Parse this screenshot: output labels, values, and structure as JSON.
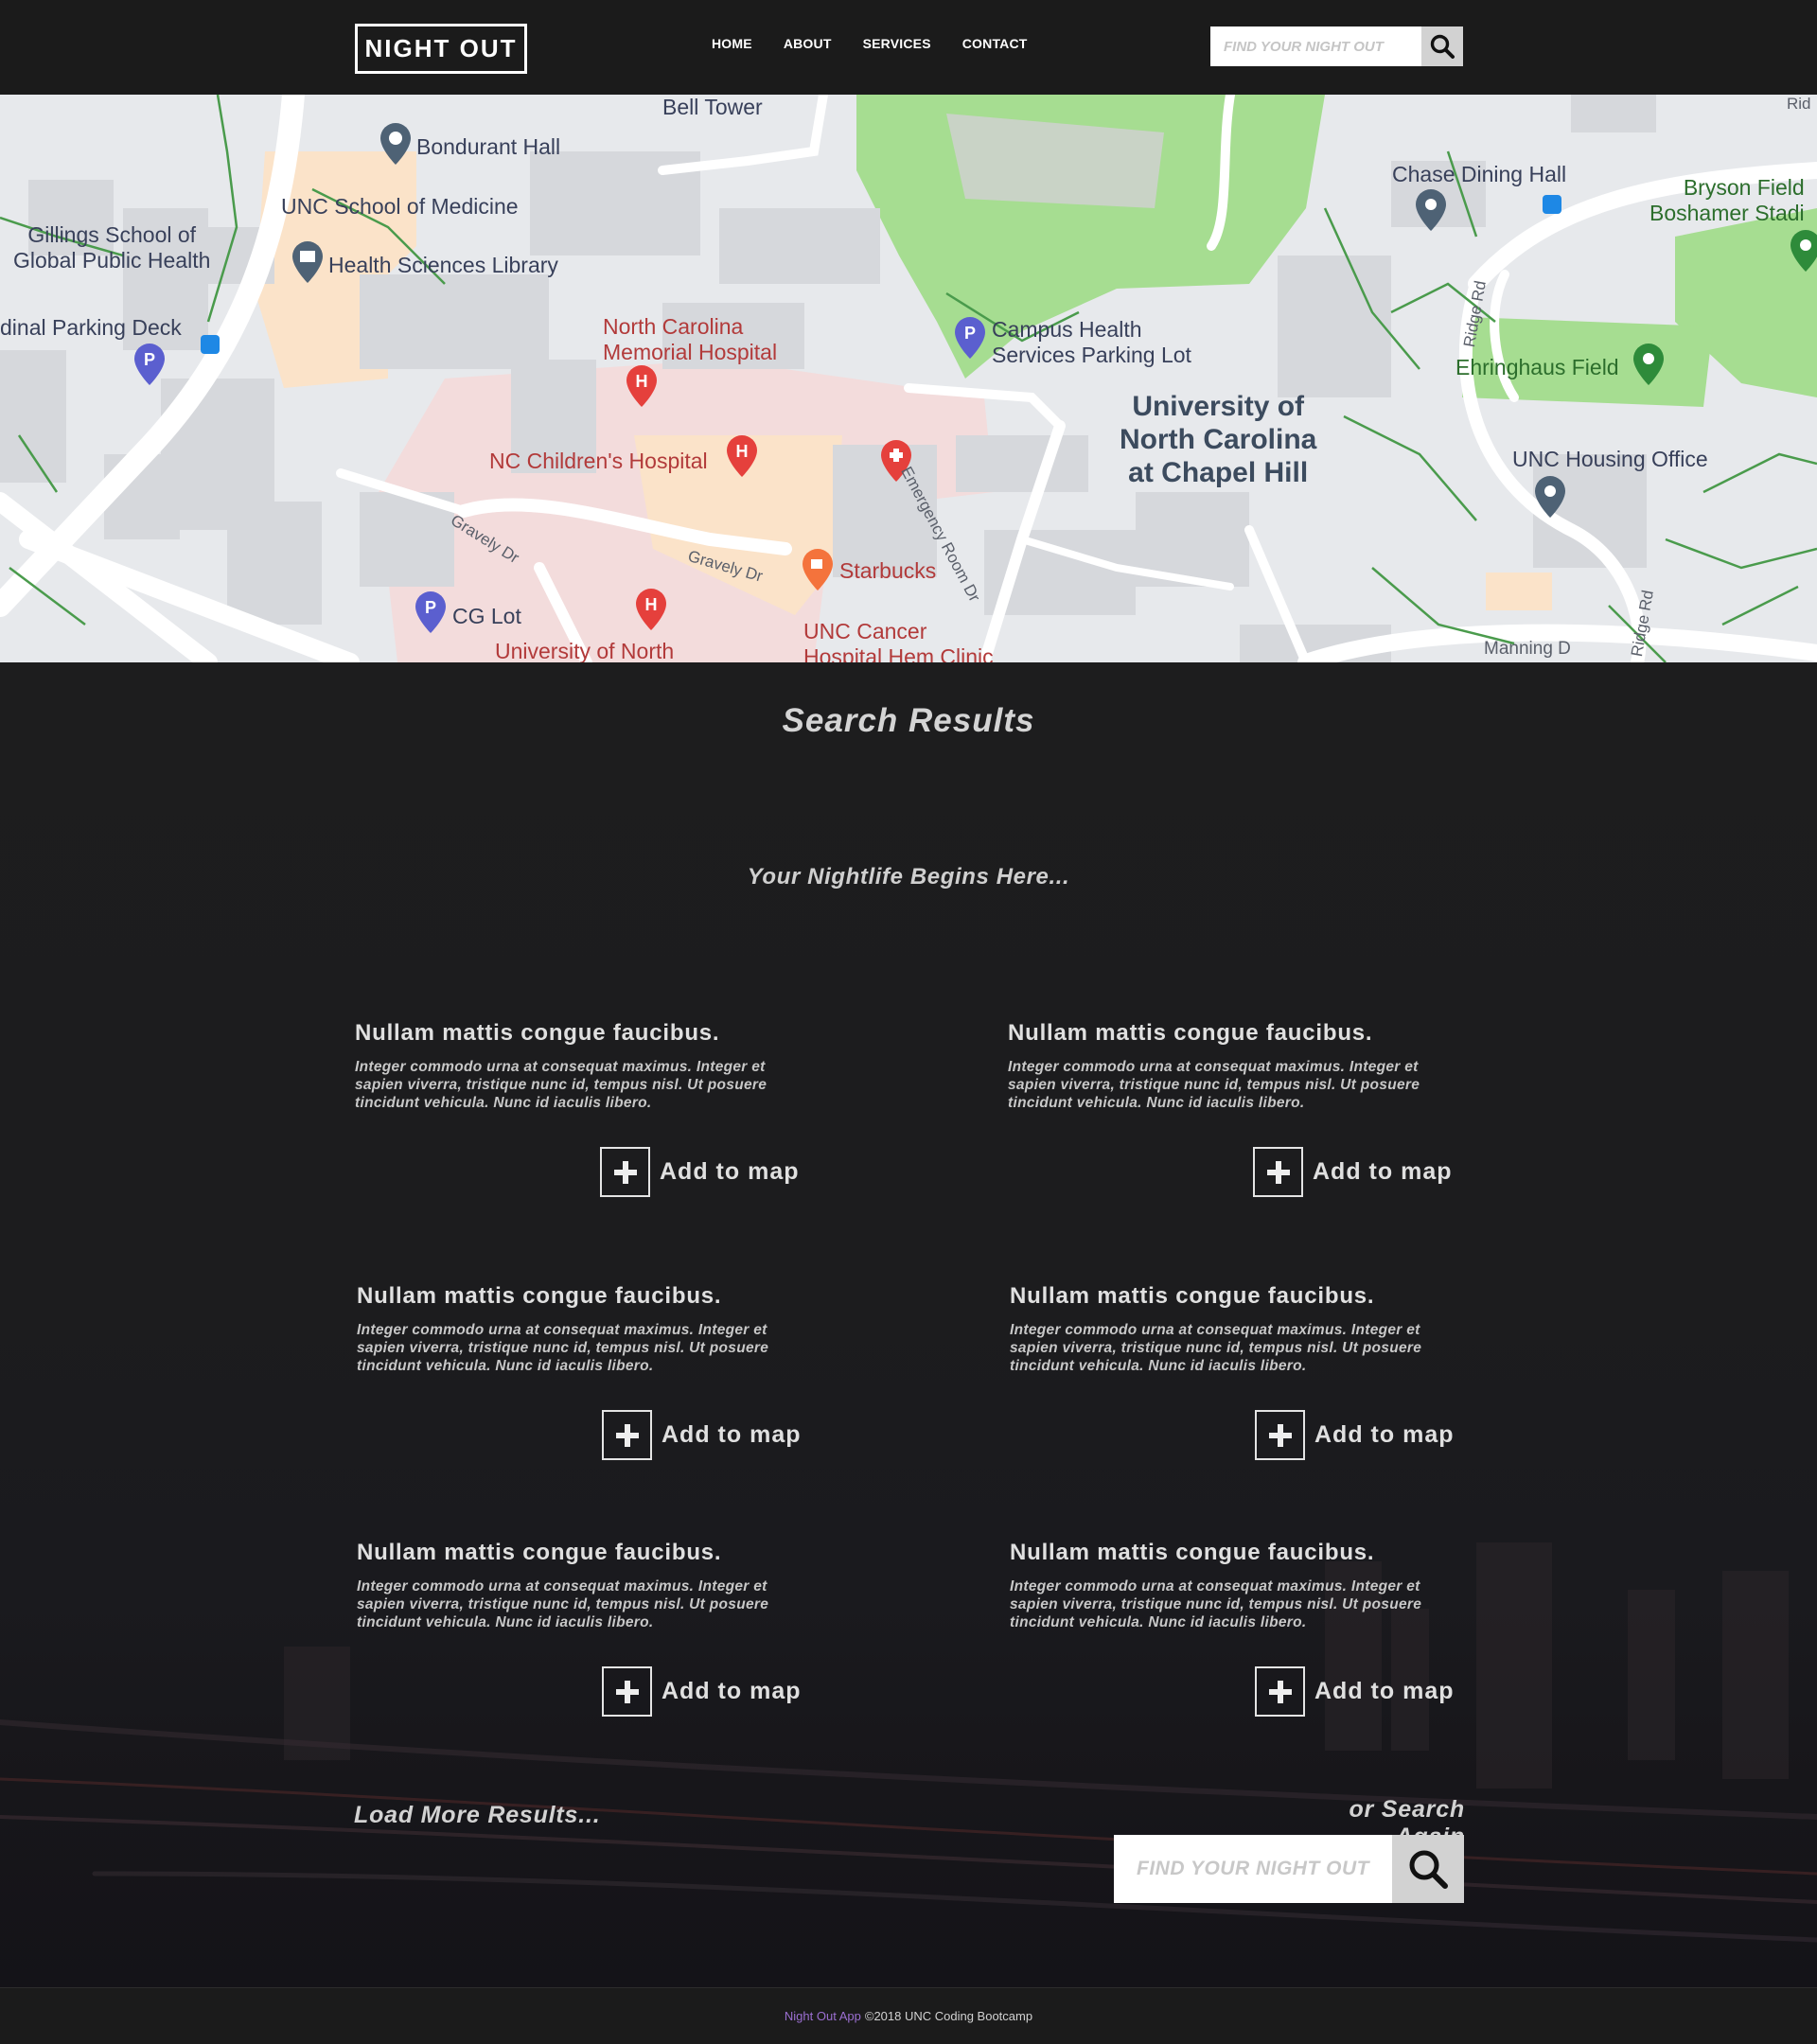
{
  "header": {
    "logo": "NIGHT OUT",
    "nav": [
      "HOME",
      "ABOUT",
      "SERVICES",
      "CONTACT"
    ],
    "search_placeholder": "FIND YOUR NIGHT OUT"
  },
  "map": {
    "labels": {
      "bell_tower": "Bell Tower",
      "bondurant": "Bondurant Hall",
      "school_medicine": "UNC School of Medicine",
      "gillings": "Gillings School of\nGlobal Public Health",
      "hs_library": "Health Sciences Library",
      "parking_deck": "dinal Parking Deck",
      "nc_memorial": "North Carolina\nMemorial Hospital",
      "childrens": "NC Children's Hospital",
      "campus_health": "Campus Health\nServices Parking Lot",
      "unc": "University of\nNorth Carolina\nat Chapel Hill",
      "chase": "Chase Dining Hall",
      "bryson": "Bryson Field\nBoshamer Stadi",
      "ehringhaus": "Ehringhaus Field",
      "housing": "UNC Housing Office",
      "starbucks": "Starbucks",
      "cancer": "UNC Cancer\nHospital Hem Clinic",
      "cg_lot": "CG Lot",
      "univ_north": "University of North",
      "emergency": "Emergency Room Dr",
      "gravely1": "Gravely Dr",
      "gravely2": "Gravely Dr",
      "ridge1": "Ridge Rd",
      "ridge2": "Ridge Rd",
      "manning": "Manning D",
      "rid": "Rid"
    }
  },
  "results": {
    "title": "Search Results",
    "tagline": "Your Nightlife Begins Here...",
    "add_label": "Add to map",
    "items": [
      {
        "title": "Nullam mattis congue faucibus.",
        "body": "Integer commodo urna at consequat maximus. Integer et sapien viverra, tristique nunc id, tempus nisl. Ut posuere tincidunt vehicula. Nunc id iaculis libero."
      },
      {
        "title": "Nullam mattis congue faucibus.",
        "body": "Integer commodo urna at consequat maximus. Integer et sapien viverra, tristique nunc id, tempus nisl. Ut posuere tincidunt vehicula. Nunc id iaculis libero."
      },
      {
        "title": "Nullam mattis congue faucibus.",
        "body": "Integer commodo urna at consequat maximus. Integer et sapien viverra, tristique nunc id, tempus nisl. Ut posuere tincidunt vehicula. Nunc id iaculis libero."
      },
      {
        "title": "Nullam mattis congue faucibus.",
        "body": "Integer commodo urna at consequat maximus. Integer et sapien viverra, tristique nunc id, tempus nisl. Ut posuere tincidunt vehicula. Nunc id iaculis libero."
      },
      {
        "title": "Nullam mattis congue faucibus.",
        "body": "Integer commodo urna at consequat maximus. Integer et sapien viverra, tristique nunc id, tempus nisl. Ut posuere tincidunt vehicula. Nunc id iaculis libero."
      },
      {
        "title": "Nullam mattis congue faucibus.",
        "body": "Integer commodo urna at consequat maximus. Integer et sapien viverra, tristique nunc id, tempus nisl. Ut posuere tincidunt vehicula. Nunc id iaculis libero."
      }
    ],
    "load_more": "Load More Results...",
    "search_again": "or Search Again",
    "search_placeholder": "FIND YOUR NIGHT OUT"
  },
  "footer": {
    "brand": "Night Out App",
    "copyright": "©2018 UNC Coding Bootcamp"
  },
  "colors": {
    "background": "#1d1d1e",
    "footer_brand": "#9b6fd1"
  }
}
